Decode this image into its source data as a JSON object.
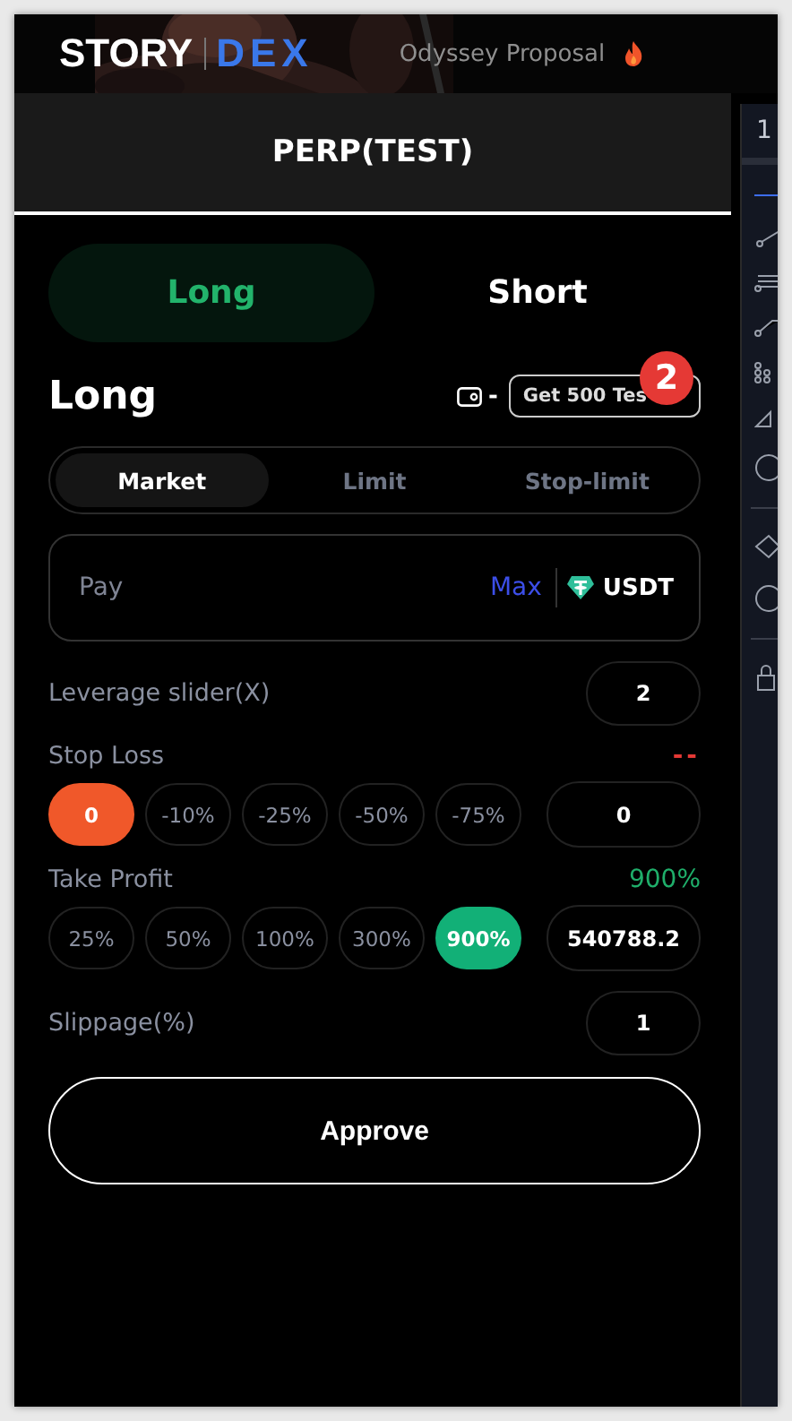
{
  "header": {
    "logo_left": "STORY",
    "logo_right": "DEX",
    "proposal_link": "Odyssey Proposal"
  },
  "panel_title": "PERP(TEST)",
  "sides": [
    {
      "label": "Long",
      "selected": true
    },
    {
      "label": "Short",
      "selected": false
    }
  ],
  "order_heading": "Long",
  "wallet_balance": "-",
  "faucet_button": "Get 500 Tes",
  "annotation_badge": "2",
  "order_types": [
    {
      "label": "Market",
      "selected": true
    },
    {
      "label": "Limit",
      "selected": false
    },
    {
      "label": "Stop-limit",
      "selected": false
    }
  ],
  "pay": {
    "placeholder": "Pay",
    "max": "Max",
    "token": "USDT"
  },
  "leverage": {
    "label": "Leverage slider(X)",
    "value": "2"
  },
  "triggers": [
    {
      "kind": "loss",
      "label": "Stop Loss",
      "reading": "--",
      "value": "0",
      "options": [
        {
          "label": "0",
          "selected": true
        },
        {
          "label": "-10%",
          "selected": false
        },
        {
          "label": "-25%",
          "selected": false
        },
        {
          "label": "-50%",
          "selected": false
        },
        {
          "label": "-75%",
          "selected": false
        }
      ]
    },
    {
      "kind": "profit",
      "label": "Take Profit",
      "reading": "900%",
      "value": "540788.2",
      "options": [
        {
          "label": "25%",
          "selected": false
        },
        {
          "label": "50%",
          "selected": false
        },
        {
          "label": "100%",
          "selected": false
        },
        {
          "label": "300%",
          "selected": false
        },
        {
          "label": "900%",
          "selected": true
        }
      ]
    }
  ],
  "slippage": {
    "label": "Slippage(%)",
    "value": "1"
  },
  "approve_button": "Approve",
  "chart_panel": {
    "interval": "1"
  }
}
